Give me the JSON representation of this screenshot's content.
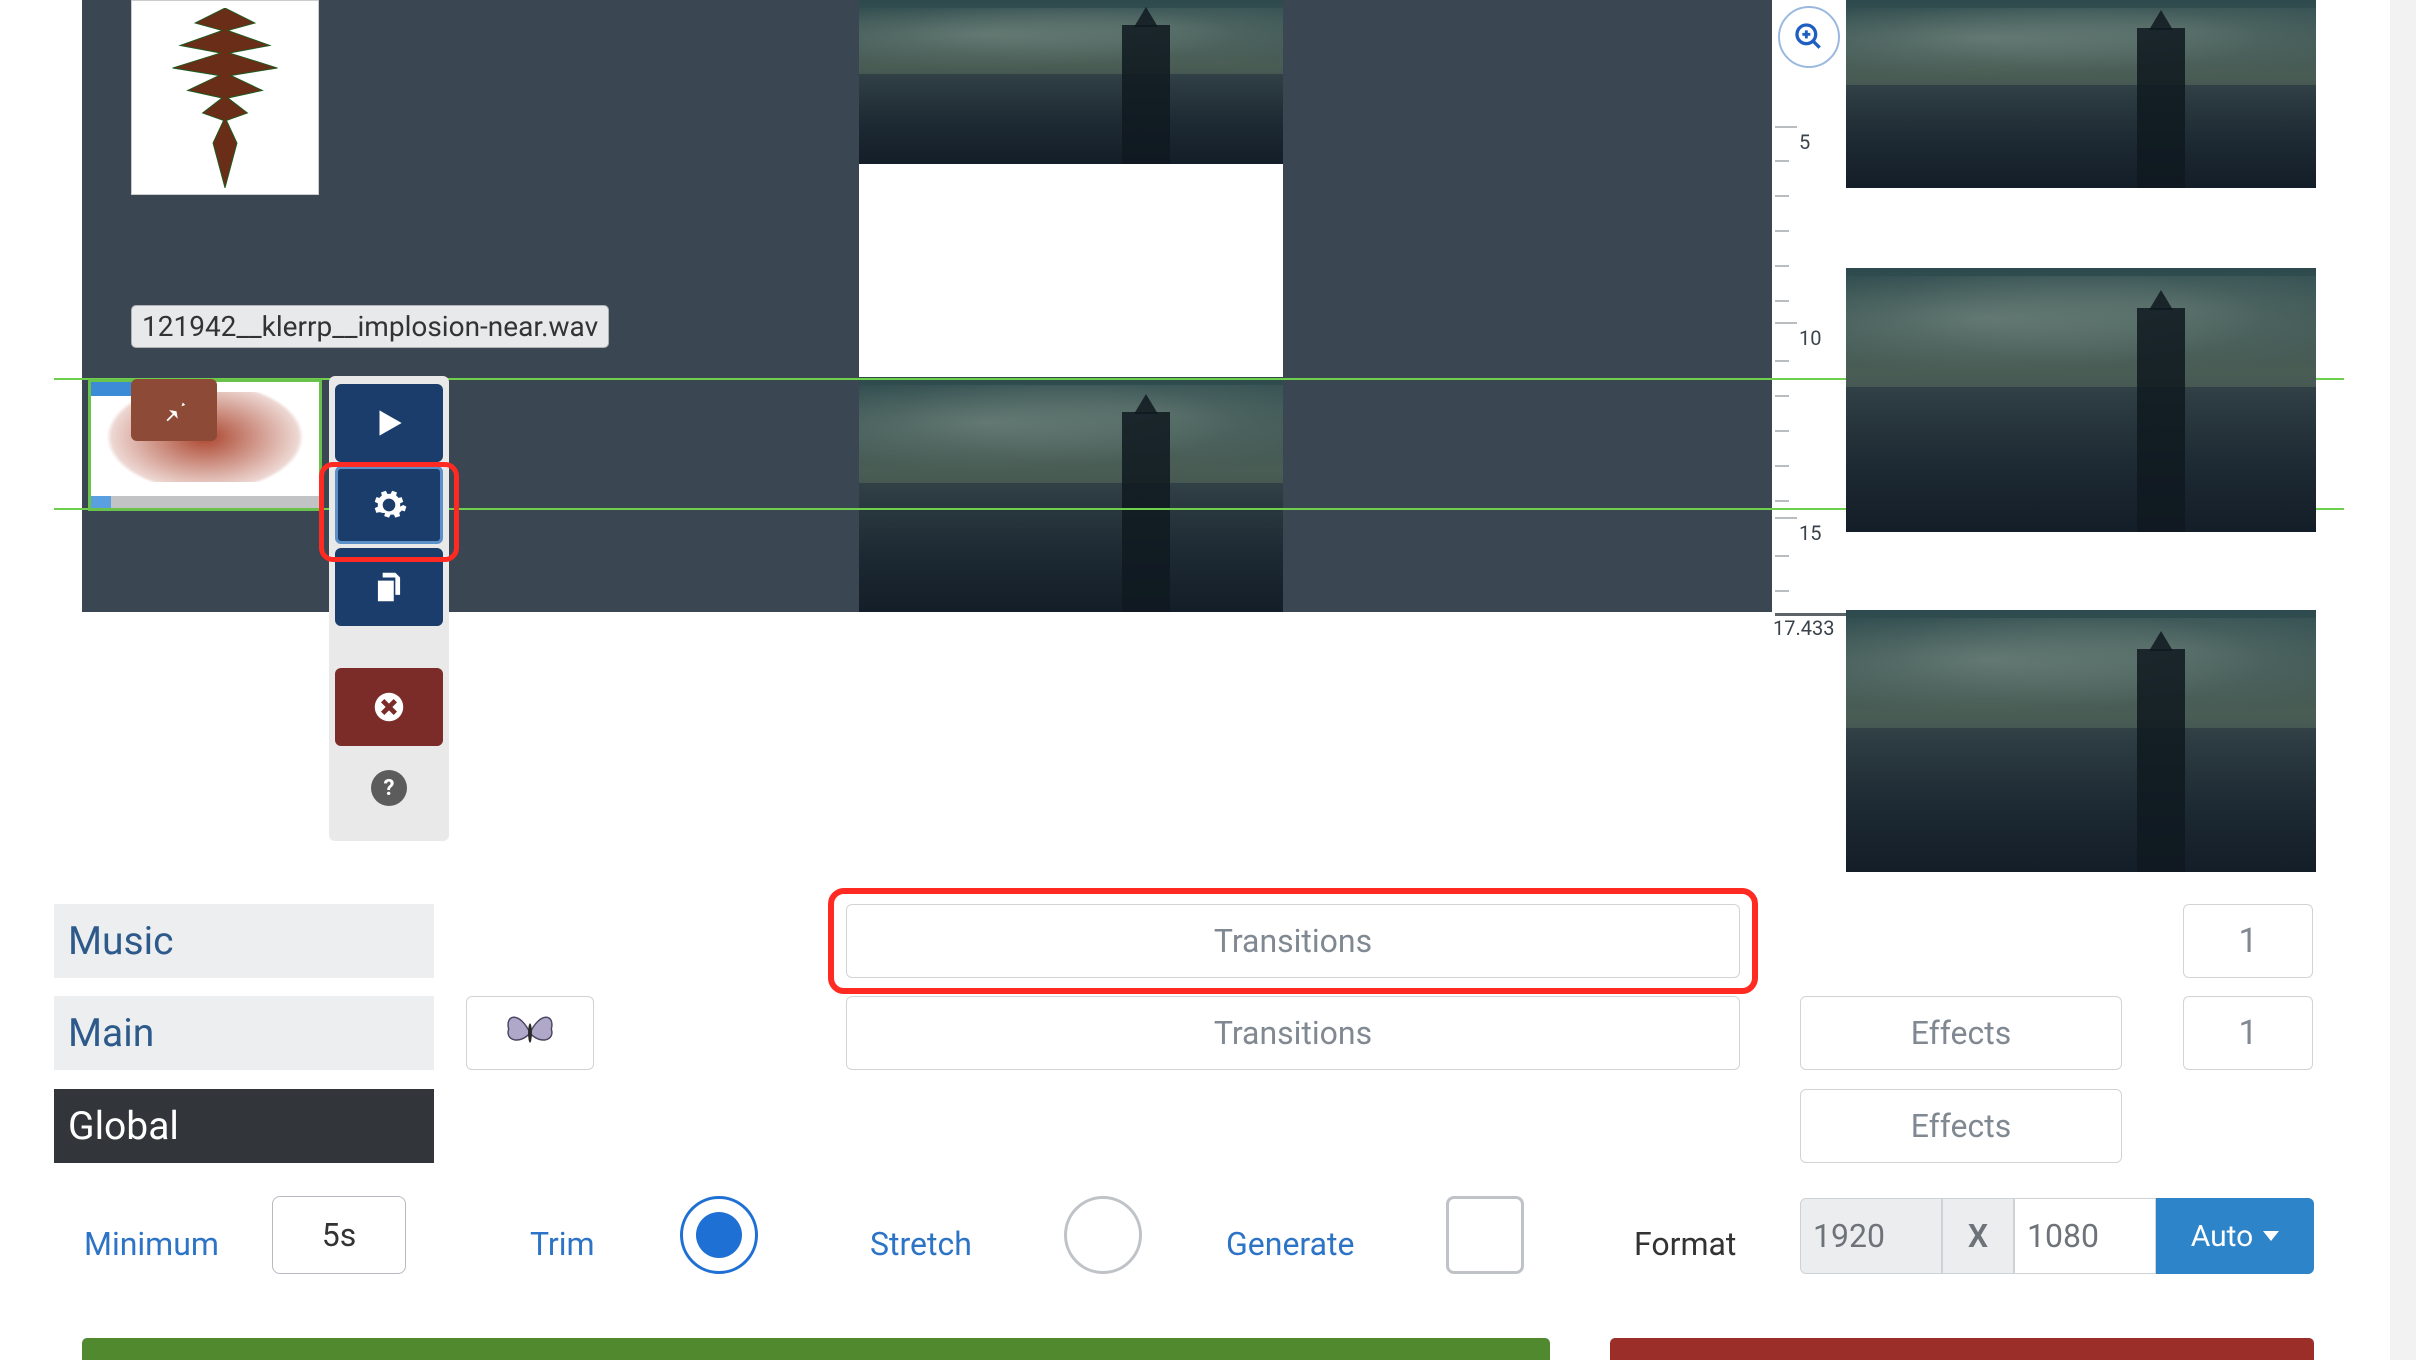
{
  "clip": {
    "filename": "121942__klerrp__implosion-near.wav"
  },
  "ruler": {
    "t5": "5",
    "t10": "10",
    "t15": "15",
    "tend": "17.433"
  },
  "layers": {
    "music": "Music",
    "main": "Main",
    "global": "Global"
  },
  "transitions_label": "Transitions",
  "effects_label": "Effects",
  "counts": {
    "music": "1",
    "main": "1"
  },
  "controls": {
    "minimum_label": "Minimum",
    "minimum_value": "5s",
    "trim_label": "Trim",
    "stretch_label": "Stretch",
    "generate_label": "Generate",
    "format_label": "Format",
    "width": "1920",
    "x": "X",
    "height": "1080",
    "auto": "Auto"
  }
}
